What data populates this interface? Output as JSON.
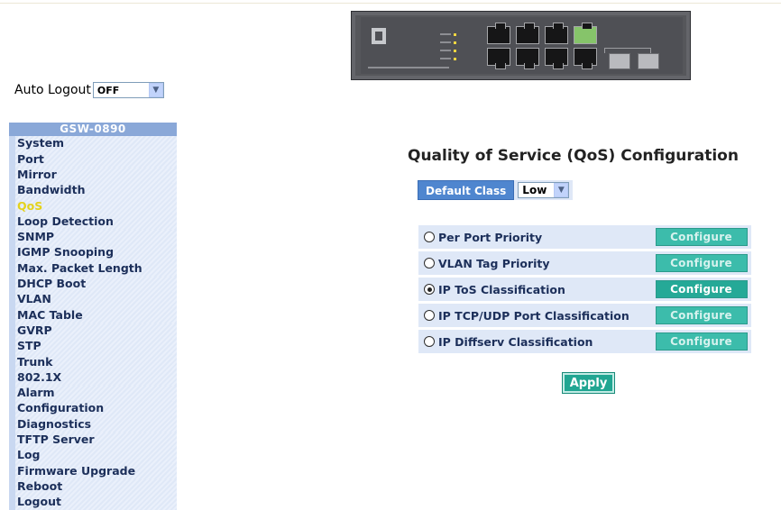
{
  "auto_logout": {
    "label": "Auto Logout",
    "value": "OFF"
  },
  "sidebar": {
    "title": "GSW-0890",
    "active": "QoS",
    "items": [
      {
        "label": "System"
      },
      {
        "label": "Port"
      },
      {
        "label": "Mirror"
      },
      {
        "label": "Bandwidth"
      },
      {
        "label": "QoS"
      },
      {
        "label": "Loop Detection"
      },
      {
        "label": "SNMP"
      },
      {
        "label": "IGMP Snooping"
      },
      {
        "label": "Max. Packet Length"
      },
      {
        "label": "DHCP Boot"
      },
      {
        "label": "VLAN"
      },
      {
        "label": "MAC Table"
      },
      {
        "label": "GVRP"
      },
      {
        "label": "STP"
      },
      {
        "label": "Trunk"
      },
      {
        "label": "802.1X"
      },
      {
        "label": "Alarm"
      },
      {
        "label": "Configuration"
      },
      {
        "label": "Diagnostics"
      },
      {
        "label": "TFTP Server"
      },
      {
        "label": "Log"
      },
      {
        "label": "Firmware Upgrade"
      },
      {
        "label": "Reboot"
      },
      {
        "label": "Logout"
      }
    ]
  },
  "main": {
    "title": "Quality of Service (QoS) Configuration",
    "default_class": {
      "label": "Default Class",
      "value": "Low"
    },
    "options": [
      {
        "label": "Per Port Priority",
        "checked": false,
        "button": "Configure",
        "enabled": false
      },
      {
        "label": "VLAN Tag Priority",
        "checked": false,
        "button": "Configure",
        "enabled": false
      },
      {
        "label": "IP ToS Classification",
        "checked": true,
        "button": "Configure",
        "enabled": true
      },
      {
        "label": "IP TCP/UDP Port Classification",
        "checked": false,
        "button": "Configure",
        "enabled": false
      },
      {
        "label": "IP Diffserv Classification",
        "checked": false,
        "button": "Configure",
        "enabled": false
      }
    ],
    "apply_label": "Apply"
  },
  "icons": {
    "dropdown": "chevron-down-icon",
    "radio": "radio-icon"
  },
  "colors": {
    "sidebar_header": "#8aa8d8",
    "active_item": "#e4d21c",
    "button": "#25a997",
    "default_class_label": "#4f86cf"
  }
}
